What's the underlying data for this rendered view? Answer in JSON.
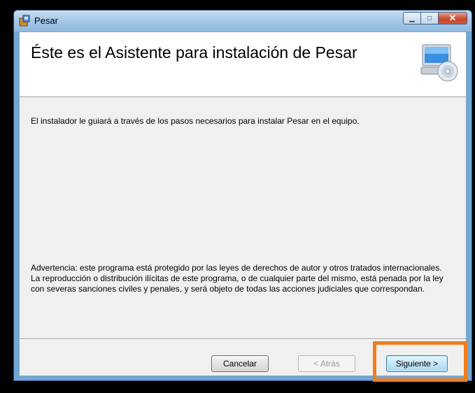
{
  "window": {
    "title": "Pesar"
  },
  "header": {
    "title": "Éste es el Asistente para instalación de Pesar",
    "icon": "computer-cd-icon"
  },
  "body": {
    "intro": "El instalador le guiará a través de los pasos necesarios para instalar Pesar en el equipo.",
    "warning": "Advertencia: este programa está protegido por las leyes de derechos de autor y otros tratados internacionales. La reproducción o distribución ilícitas de este programa, o de cualquier parte del mismo, está penada por la ley con severas sanciones civiles y penales, y será objeto de todas las acciones judiciales que correspondan."
  },
  "buttons": {
    "cancel": "Cancelar",
    "back": "< Atrás",
    "next": "Siguiente >"
  },
  "colors": {
    "highlight": "#f07d1a"
  }
}
